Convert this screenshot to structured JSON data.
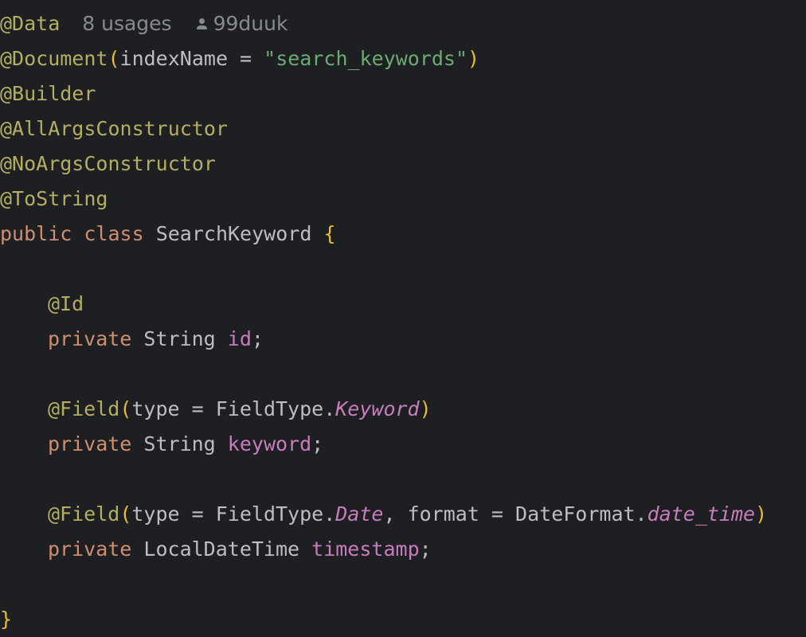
{
  "inlay_hints": {
    "usages": "8 usages",
    "author": "99duuk",
    "author_icon": "person-icon"
  },
  "code": {
    "ann_data": "@Data",
    "ann_document": "@Document",
    "paren_open": "(",
    "paren_close": ")",
    "param_index_name": "indexName = ",
    "index_name_value": "\"search_keywords\"",
    "ann_builder": "@Builder",
    "ann_all_args": "@AllArgsConstructor",
    "ann_no_args": "@NoArgsConstructor",
    "ann_to_string": "@ToString",
    "kw_public": "public",
    "kw_class": "class",
    "class_name": "SearchKeyword",
    "brace_open": "{",
    "brace_close": "}",
    "ann_id": "@Id",
    "kw_private": "private",
    "type_string": "String",
    "type_local_date_time": "LocalDateTime",
    "field_id": "id",
    "field_keyword": "keyword",
    "field_timestamp": "timestamp",
    "semicolon": ";",
    "ann_field": "@Field",
    "param_type": "type = ",
    "field_type_class": "FieldType.",
    "field_type_keyword": "Keyword",
    "field_type_date": "Date",
    "comma_sep": ", ",
    "param_format": "format = ",
    "date_format_class": "DateFormat.",
    "date_format_value": "date_time"
  },
  "colors": {
    "background": "#1e1f22",
    "annotation": "#b3ae60",
    "keyword": "#cf8e6d",
    "string": "#6aab73",
    "field": "#c77dbb",
    "bracket": "#e8ba36",
    "text": "#bcbec4",
    "hint": "#868a91"
  }
}
